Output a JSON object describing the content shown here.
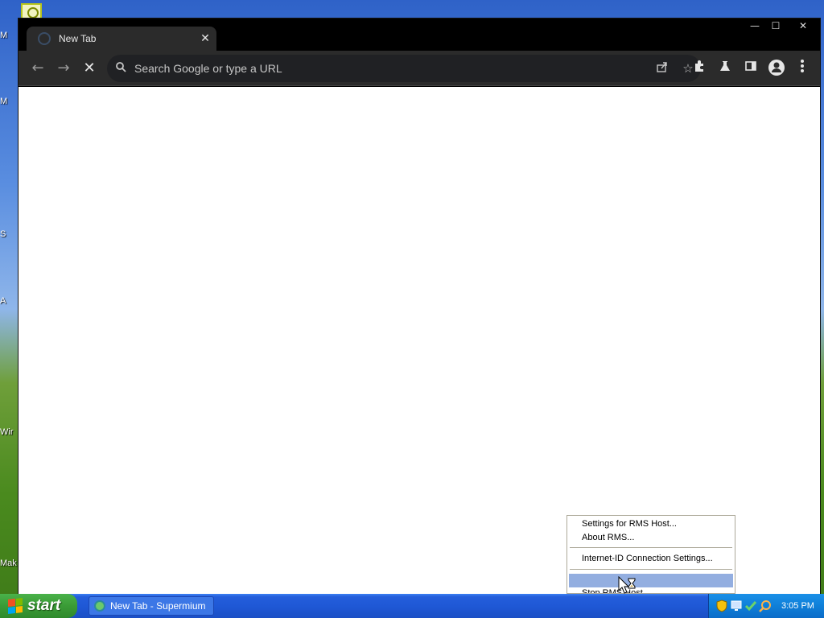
{
  "desktop": {
    "edge_labels": [
      "M",
      "M",
      "S",
      "A",
      "Wir",
      "Mak"
    ]
  },
  "browser": {
    "tab": {
      "title": "New Tab",
      "close_symbol": "✕"
    },
    "window_controls": {
      "minimize": "—",
      "maximize": "☐",
      "close": "✕"
    },
    "toolbar": {
      "back_icon": "←",
      "forward_icon": "→",
      "stop_icon": "✕",
      "omnibox_placeholder": "Search Google or type a URL"
    }
  },
  "context_menu": {
    "items": [
      "Settings for RMS Host...",
      "About RMS...",
      "Internet-ID Connection Settings...",
      "",
      "Stop RMS Host"
    ]
  },
  "taskbar": {
    "start_label": "start",
    "task_label": "New Tab - Supermium",
    "clock": "3:05 PM"
  },
  "colors": {
    "chrome_dark": "#2b2b2b",
    "omnibox": "#202124",
    "taskbar_blue": "#245edb",
    "start_green": "#3a9b36",
    "menu_highlight": "#93aee0"
  }
}
